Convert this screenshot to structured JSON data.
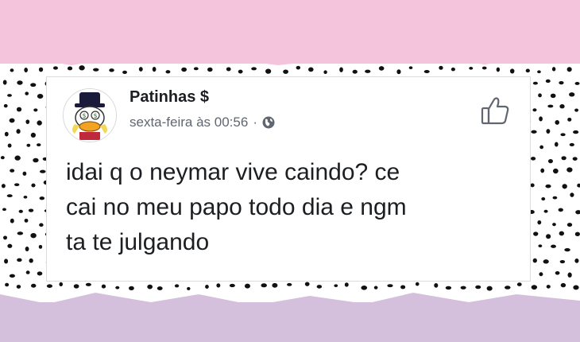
{
  "post": {
    "author": "Patinhas $",
    "time": "sexta-feira às 00:56",
    "separator": "·",
    "lines": [
      "idai q o neymar vive caindo? ce",
      "cai no meu papo todo dia e ngm",
      "ta te julgando"
    ]
  },
  "icons": {
    "avatar": "scrooge-mcduck-avatar",
    "privacy": "globe-icon",
    "like": "thumbs-up-icon"
  },
  "colors": {
    "top_band": "#f4c4dc",
    "bottom_band": "#d4c0dc",
    "card": "#ffffff",
    "text": "#1c1e21",
    "meta": "#606770"
  }
}
